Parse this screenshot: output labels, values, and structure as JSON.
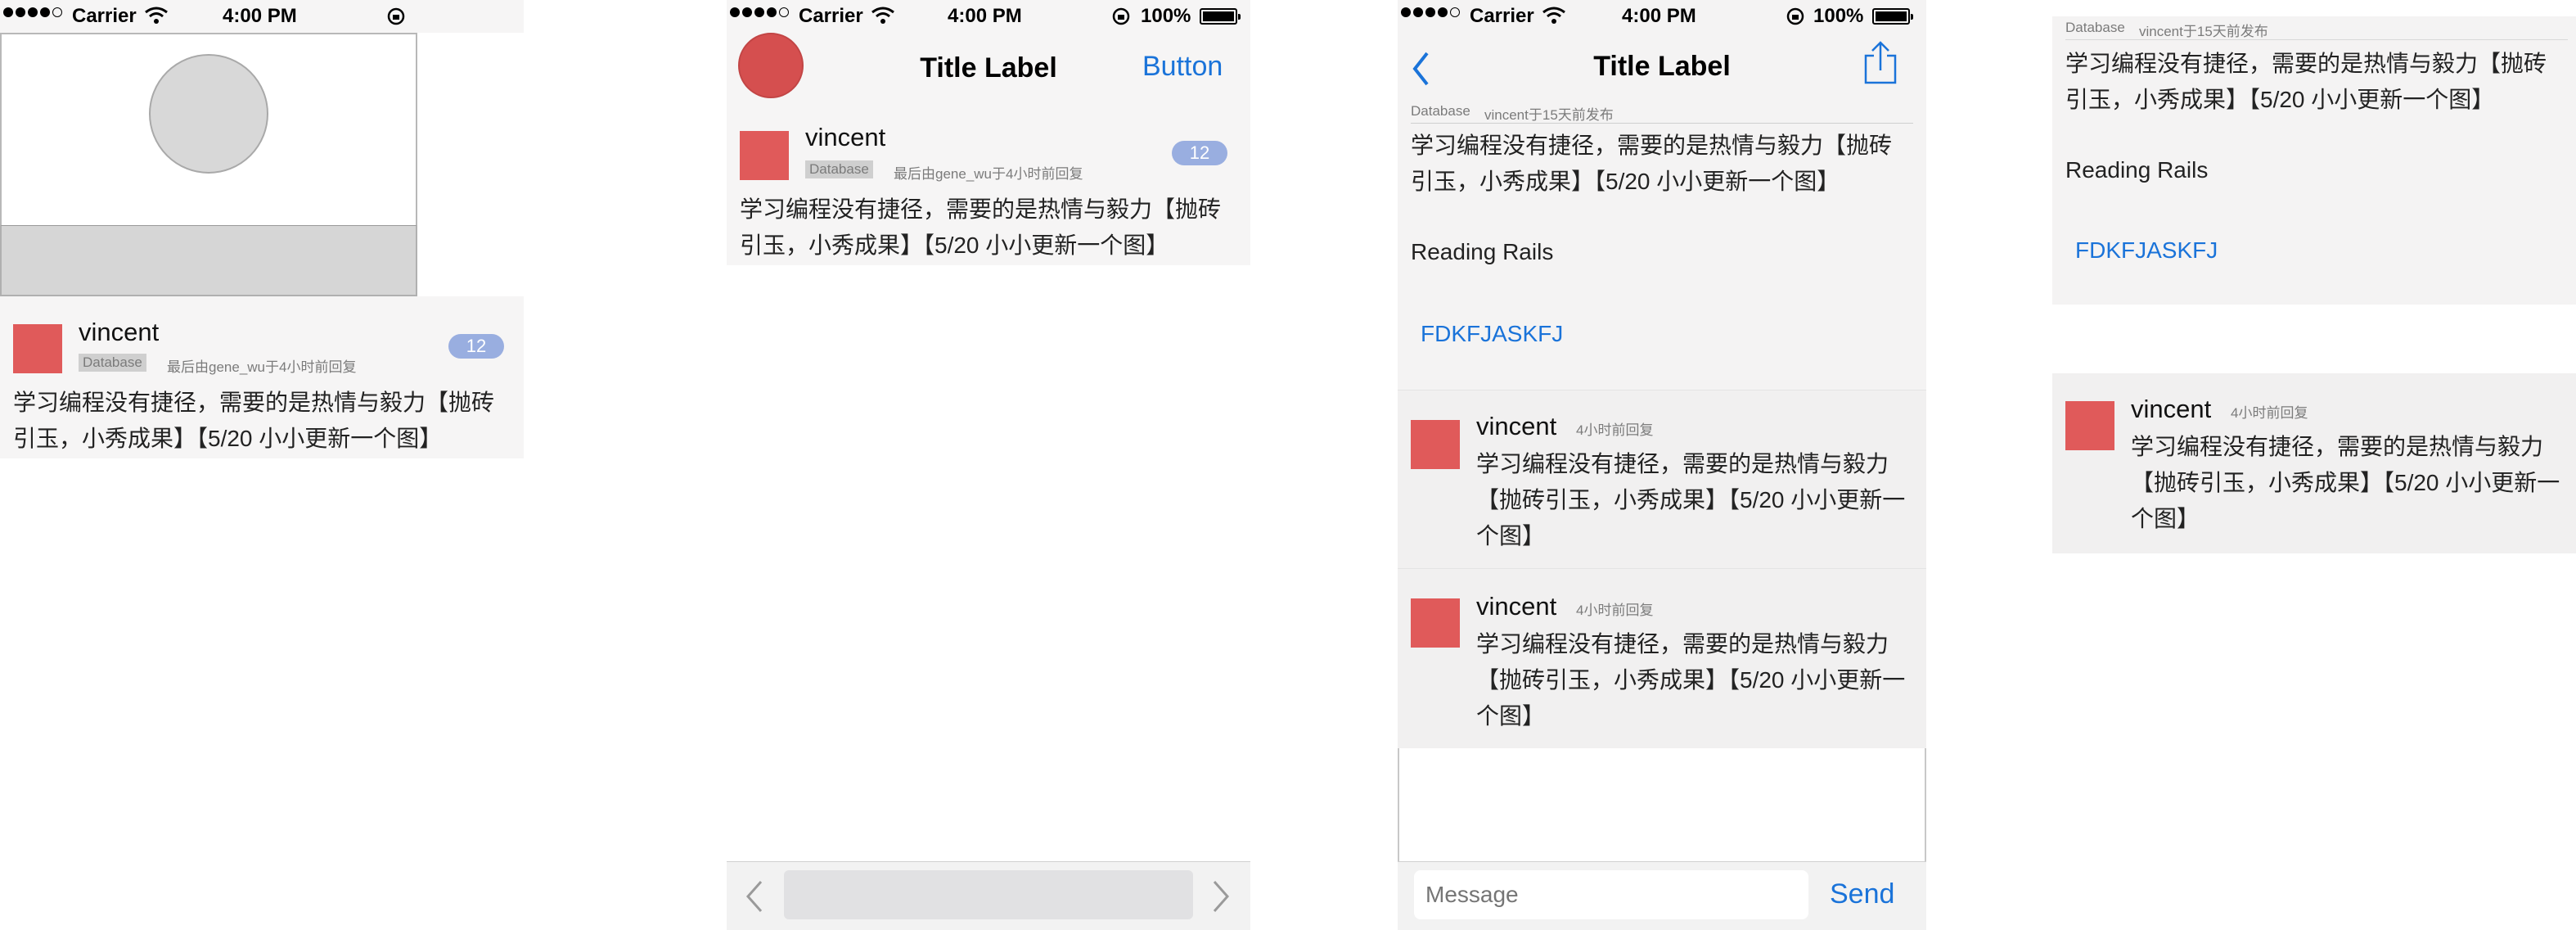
{
  "status_bar": {
    "carrier": "Carrier",
    "time": "4:00 PM",
    "battery_percent": "100%"
  },
  "nav": {
    "title": "Title Label",
    "right_button": "Button"
  },
  "topic": {
    "author": "vincent",
    "node_tag": "Database",
    "meta": "最后由gene_wu于4小时前回复",
    "reply_count": "12",
    "title": "学习编程没有捷径，需要的是热情与毅力【抛砖引玉，小秀成果】【5/20 小小更新一个图】"
  },
  "detail": {
    "node_tag": "Database",
    "posted": "vincent于15天前发布",
    "title": "学习编程没有捷径，需要的是热情与毅力【抛砖引玉，小秀成果】【5/20 小小更新一个图】",
    "body_line": "Reading Rails",
    "link": "FDKFJASKFJ"
  },
  "replies": [
    {
      "author": "vincent",
      "time": "4小时前回复",
      "text": "学习编程没有捷径，需要的是热情与毅力【抛砖引玉，小秀成果】【5/20 小小更新一个图】"
    },
    {
      "author": "vincent",
      "time": "4小时前回复",
      "text": "学习编程没有捷径，需要的是热情与毅力【抛砖引玉，小秀成果】【5/20 小小更新一个图】"
    }
  ],
  "composer": {
    "placeholder": "Message",
    "send_label": "Send"
  },
  "icons": {
    "back": "chevron-left-icon",
    "share": "share-icon",
    "toolbar_prev": "chevron-left-icon",
    "toolbar_next": "chevron-right-icon"
  },
  "colors": {
    "accent": "#1a73d9",
    "avatar": "#e05a5a",
    "badge": "#99aee0",
    "cell_background": "#f6f5f5"
  }
}
